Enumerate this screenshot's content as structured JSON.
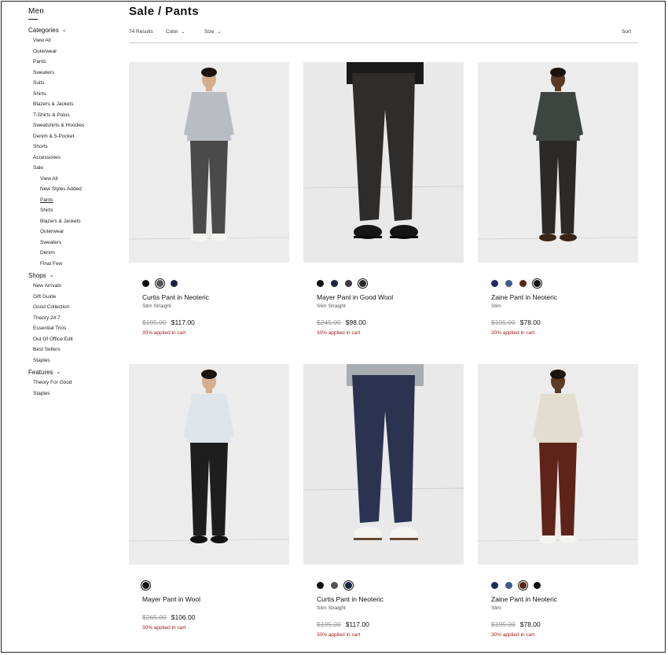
{
  "sidebar": {
    "title": "Men",
    "categories_label": "Categories",
    "categories": [
      "View All",
      "Outerwear",
      "Pants",
      "Sweaters",
      "Suits",
      "Shirts",
      "Blazers & Jackets",
      "T-Shirts & Polos",
      "Sweatshirts & Hoodies",
      "Denim & 5-Pocket",
      "Shorts",
      "Accessories",
      "Sale"
    ],
    "sale_sub": [
      "View All",
      "New Styles Added",
      "Pants",
      "Shirts",
      "Blazers & Jackets",
      "Outerwear",
      "Sweaters",
      "Denim",
      "Final Few"
    ],
    "active_sub": "Pants",
    "shops_label": "Shops",
    "shops": [
      "New Arrivals",
      "Gift Guide",
      "Good Collection",
      "Theory 24:7",
      "Essential Trios",
      "Out Of Office Edit",
      "Best Sellers",
      "Staples"
    ],
    "features_label": "Features",
    "features": [
      "Theory For Good",
      "Staples"
    ]
  },
  "header": {
    "title": "Sale / Pants",
    "results": "74 Results",
    "color_filter": "Color",
    "size_filter": "Size",
    "sort": "Sort"
  },
  "colors": {
    "promo": "#a11d1d",
    "photo_bg": "#ebebeb"
  },
  "products": [
    {
      "name": "Curtis Pant in Neoteric",
      "fit": "Slim Straight",
      "original_price": "$195.00",
      "sale_price": "$117.00",
      "promo": "30% applied in cart",
      "swatches": [
        "#111111",
        "#555555",
        "#1c2340"
      ],
      "selected_swatch": 1,
      "pant_color": "#4a4a4a",
      "top_color": "#b9bcc2"
    },
    {
      "name": "Mayer Pant in Good Wool",
      "fit": "Slim Straight",
      "original_price": "$245.00",
      "sale_price": "$98.00",
      "promo": "30% applied in cart",
      "swatches": [
        "#111111",
        "#1c2340",
        "#3b3b3b",
        "#2a2a2a"
      ],
      "selected_swatch": 3,
      "pant_color": "#2e2d2b",
      "top_color": "#1a1a1a"
    },
    {
      "name": "Zaine Pant in Neoteric",
      "fit": "Slim",
      "original_price": "$195.00",
      "sale_price": "$78.00",
      "promo": "30% applied in cart",
      "swatches": [
        "#1c2a5a",
        "#3d5a8a",
        "#5a2418",
        "#111111"
      ],
      "selected_swatch": 3,
      "pant_color": "#2c2a28",
      "top_color": "#3e4440"
    },
    {
      "name": "Mayer Pant in Wool",
      "fit": "",
      "original_price": "$265.00",
      "sale_price": "$106.00",
      "promo": "30% applied in cart",
      "swatches": [
        "#111111"
      ],
      "selected_swatch": 0,
      "pant_color": "#1e1e1e",
      "top_color": "#dfe3ea"
    },
    {
      "name": "Curtis Pant in Neoteric",
      "fit": "Slim Straight",
      "original_price": "$195.00",
      "sale_price": "$117.00",
      "promo": "30% applied in cart",
      "swatches": [
        "#111111",
        "#555555",
        "#1c2340"
      ],
      "selected_swatch": 2,
      "pant_color": "#2b3350",
      "top_color": "#a9acb0"
    },
    {
      "name": "Zaine Pant in Neoteric",
      "fit": "Slim",
      "original_price": "$195.00",
      "sale_price": "$78.00",
      "promo": "30% applied in cart",
      "swatches": [
        "#1c2a5a",
        "#3d5a8a",
        "#5a2418",
        "#111111"
      ],
      "selected_swatch": 2,
      "pant_color": "#5e2419",
      "top_color": "#e3ddd0"
    }
  ]
}
